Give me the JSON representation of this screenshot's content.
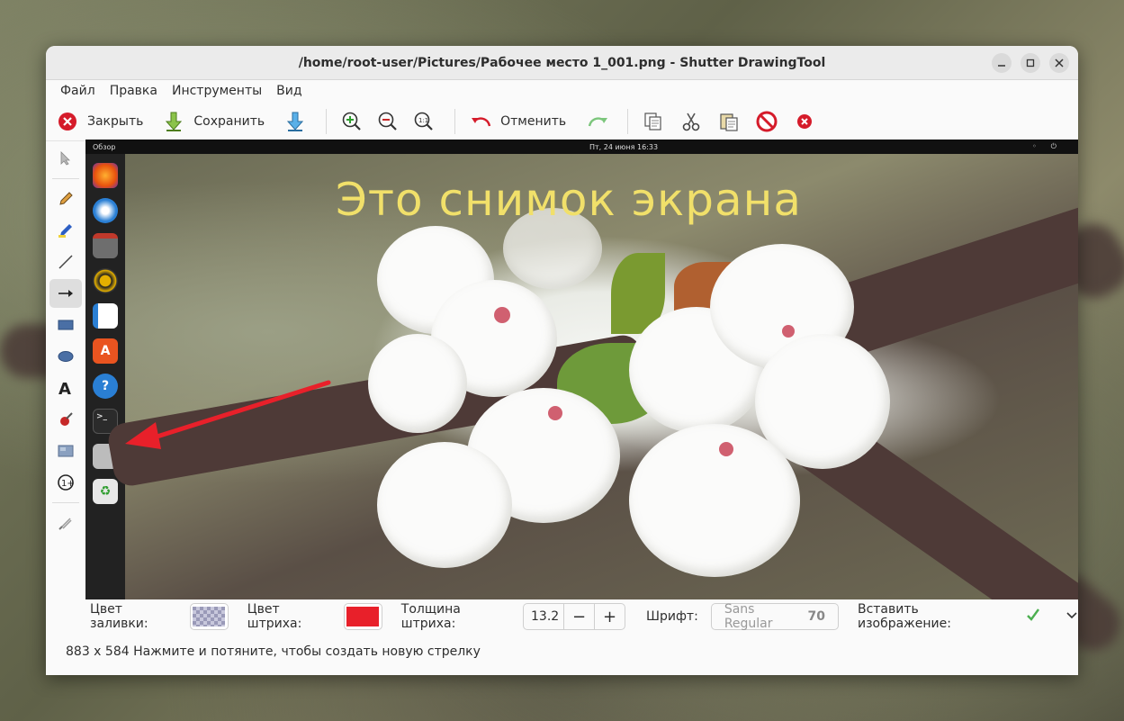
{
  "window": {
    "title": "/home/root-user/Pictures/Рабочее место 1_001.png - Shutter DrawingTool"
  },
  "menu": [
    "Файл",
    "Правка",
    "Инструменты",
    "Вид"
  ],
  "toolbar": {
    "close_label": "Закрыть",
    "save_label": "Сохранить",
    "undo_label": "Отменить"
  },
  "screenshot": {
    "topbar_left": "Обзор",
    "topbar_center": "Пт, 24 июня  16:33",
    "caption": "Это снимок экрана"
  },
  "properties": {
    "fill_color_label": "Цвет заливки:",
    "stroke_color_label": "Цвет штриха:",
    "stroke_color": "#e8202a",
    "stroke_width_label": "Толщина штриха:",
    "stroke_width": "13.2",
    "minus": "−",
    "plus": "+",
    "font_label": "Шрифт:",
    "font_name": "Sans Regular",
    "font_size": "70",
    "insert_image_label": "Вставить изображение:"
  },
  "status": {
    "text": "883 x 584 Нажмите и потяните, чтобы создать новую стрелку"
  },
  "colors": {
    "arrow": "#e8202a",
    "caption": "#f1e06a",
    "close_red": "#d51b2a"
  }
}
